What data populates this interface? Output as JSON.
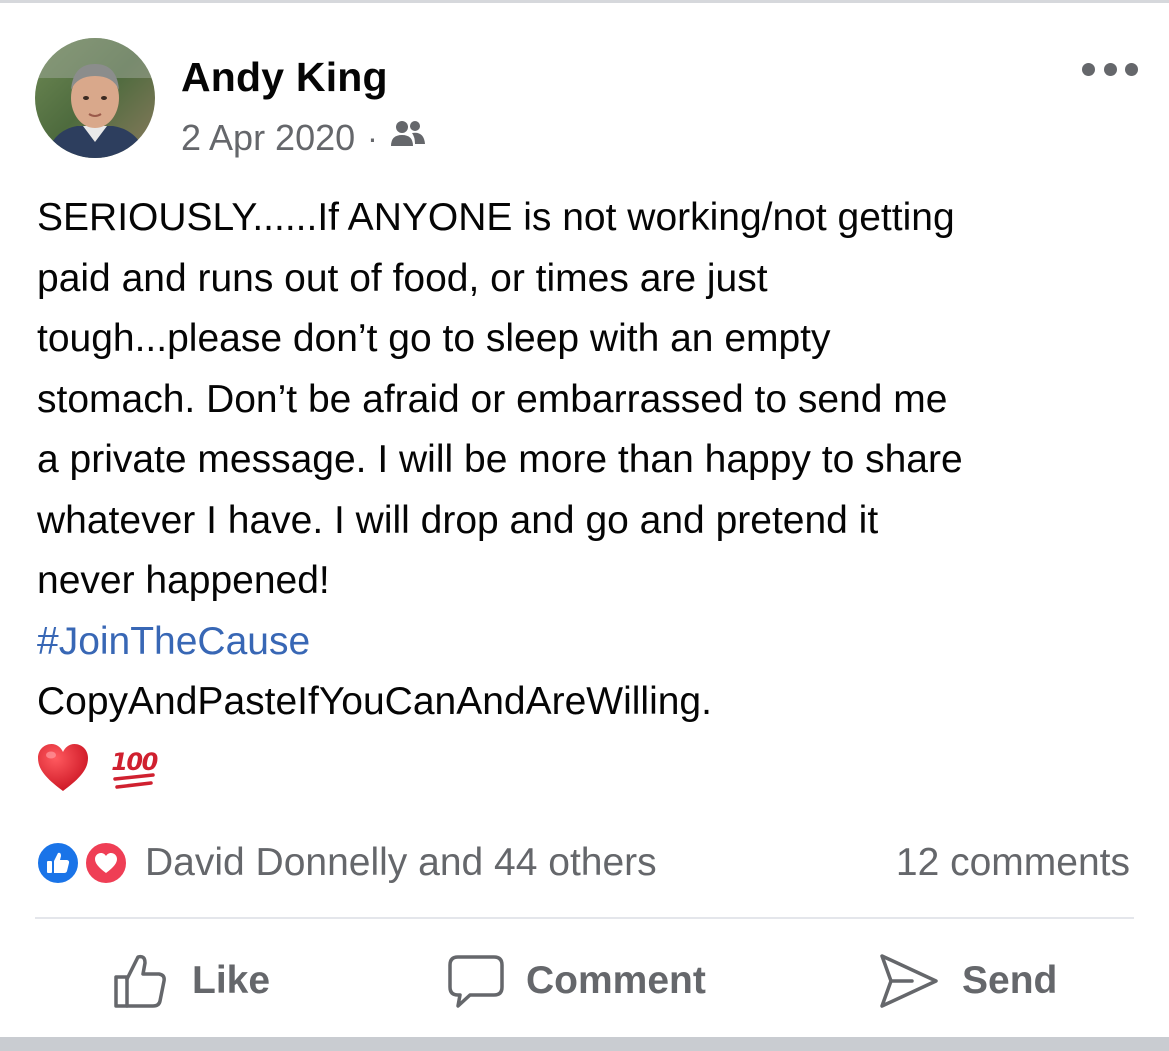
{
  "post": {
    "author": {
      "name": "Andy King",
      "avatar_icon": "profile-photo"
    },
    "timestamp": "2 Apr 2020",
    "meta_separator": "·",
    "audience_icon": "friends-icon",
    "body_lines": [
      "SERIOUSLY......If ANYONE is not working/not getting",
      "paid and runs out of food, or times are just",
      "tough...please don’t go to sleep with an empty",
      "stomach. Don’t be afraid or embarrassed to send me",
      "a private message. I will be more than happy to share",
      "whatever I have. I will drop and go and pretend it",
      "never happened!"
    ],
    "hashtag": "#JoinTheCause",
    "closing_line": "CopyAndPasteIfYouCanAndAreWilling.",
    "emojis": [
      "red-heart",
      "hundred-points"
    ],
    "hundred_emoji_text": "100"
  },
  "reactions": {
    "icons": [
      "like-reaction",
      "love-reaction"
    ],
    "summary": "David Donnelly and 44 others",
    "comments": "12 comments"
  },
  "actions": {
    "like": "Like",
    "comment": "Comment",
    "send": "Send"
  },
  "colors": {
    "hashtag": "#3867b5",
    "secondary_text": "#65676b",
    "like_blue": "#1a74e8",
    "love_red": "#ef3e55",
    "heart_red": "#e0162b",
    "hundred_red": "#d0202f"
  }
}
